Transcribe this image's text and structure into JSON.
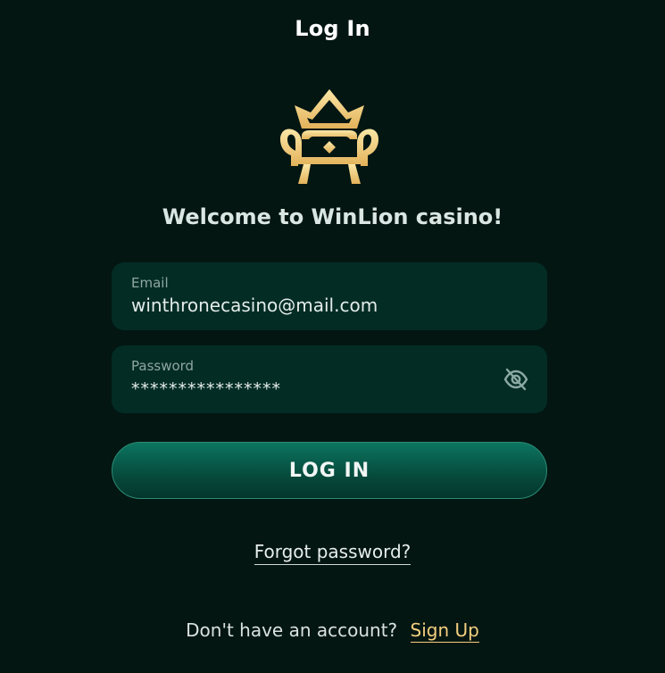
{
  "header": {
    "title": "Log In"
  },
  "logo": {
    "icon": "crown-throne-icon",
    "color_light": "#F8DE8E",
    "color_dark": "#E6B45A"
  },
  "welcome": {
    "text": "Welcome to WinLion casino!"
  },
  "form": {
    "email": {
      "label": "Email",
      "value": "winthronecasino@mail.com"
    },
    "password": {
      "label": "Password",
      "value": "****************",
      "toggle_icon": "eye-off-icon"
    },
    "submit_label": "LOG IN"
  },
  "links": {
    "forgot_password": "Forgot password?",
    "no_account_text": "Don't have an account?",
    "sign_up": "Sign Up"
  },
  "colors": {
    "background": "#031612",
    "field_background": "#032C25",
    "button_background": "#0C7560",
    "accent_gold": "#F3CF7E"
  }
}
